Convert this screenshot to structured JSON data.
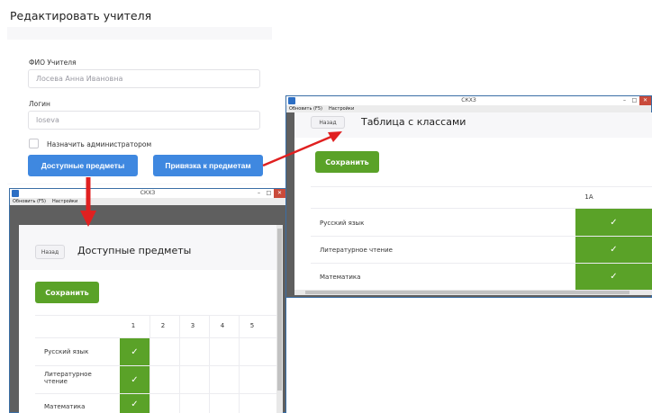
{
  "edit_page": {
    "title": "Редактировать учителя",
    "fio_label": "ФИО Учителя",
    "fio_value": "Лосева Анна Ивановна",
    "login_label": "Логин",
    "login_value": "loseva",
    "admin_checkbox_label": "Назначить администратором",
    "admin_checked": false,
    "available_subjects_button": "Доступные предметы",
    "subject_binding_button": "Привязка к предметам"
  },
  "window_left": {
    "title": "СКХЗ",
    "menu": [
      "Обновить (F5)",
      "Настройки"
    ],
    "back_button": "Назад",
    "page_title": "Доступные предметы",
    "save_button": "Сохранить",
    "columns": [
      "1",
      "2",
      "3",
      "4",
      "5"
    ],
    "rows": [
      {
        "subject": "Русский язык",
        "checked": [
          true,
          false,
          false,
          false,
          false
        ]
      },
      {
        "subject": "Литературное чтение",
        "checked": [
          true,
          false,
          false,
          false,
          false
        ]
      },
      {
        "subject": "Математика",
        "checked": [
          true,
          false,
          false,
          false,
          false
        ]
      }
    ]
  },
  "window_right": {
    "title": "СКХЗ",
    "menu": [
      "Обновить (F5)",
      "Настройки"
    ],
    "back_button": "Назад",
    "page_title": "Таблица с классами",
    "save_button": "Сохранить",
    "columns": [
      "1А"
    ],
    "rows": [
      {
        "subject": "Русский язык",
        "checked": [
          true
        ]
      },
      {
        "subject": "Литературное чтение",
        "checked": [
          true
        ]
      },
      {
        "subject": "Математика",
        "checked": [
          true
        ]
      }
    ]
  },
  "icons": {
    "check": "✓",
    "minimize": "–",
    "maximize": "□",
    "close": "✕"
  },
  "colors": {
    "blue_button": "#3f88e0",
    "green_button": "#5aa228",
    "arrow": "#e02020"
  }
}
